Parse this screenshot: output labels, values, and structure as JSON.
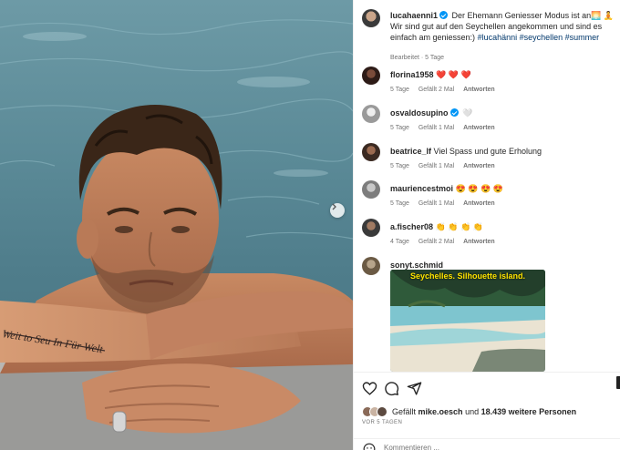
{
  "post": {
    "author": "lucahaenni1",
    "caption_text": "Der Ehemann Geniesser Modus ist an🌅 🧘 Wir sind gut auf den Seychellen angekommen und sind es einfach am geniessen:) ",
    "hashtags": "#lucahänni #seychellen #summer",
    "meta": "Bearbeitet · 5 Tage"
  },
  "comments": [
    {
      "user": "florina1958",
      "text": "❤️ ❤️ ❤️",
      "age": "5 Tage",
      "likes": "Gefällt 2 Mal",
      "reply": "Antworten",
      "verified": false
    },
    {
      "user": "osvaldosupino",
      "text": "🤍",
      "age": "5 Tage",
      "likes": "Gefällt 1 Mal",
      "reply": "Antworten",
      "verified": true
    },
    {
      "user": "beatrice_lf",
      "text": "Viel Spass und gute Erholung",
      "age": "5 Tage",
      "likes": "Gefällt 1 Mal",
      "reply": "Antworten",
      "verified": false
    },
    {
      "user": "mauriencestmoi",
      "text": "😍 😍 😍 😍",
      "age": "5 Tage",
      "likes": "Gefällt 1 Mal",
      "reply": "Antworten",
      "verified": false
    },
    {
      "user": "a.fischer08",
      "text": "👏 👏 👏 👏",
      "age": "4 Tage",
      "likes": "Gefällt 2 Mal",
      "reply": "Antworten",
      "verified": false
    },
    {
      "user": "sonyt.schmid",
      "text": "",
      "age": "",
      "likes": "",
      "reply": "",
      "verified": false
    }
  ],
  "embed": {
    "title": "Seychelles. Silhouette island."
  },
  "likes": {
    "prefix": "Gefällt",
    "user": "mike.oesch",
    "middle": "und",
    "count": "18.439 weitere Personen"
  },
  "age_label": "VOR 5 TAGEN",
  "comment_input": {
    "placeholder": "Kommentieren ..."
  },
  "icons": [
    "heart-icon",
    "comment-icon",
    "share-icon",
    "chevron-right-icon",
    "emoji-icon"
  ],
  "colors": {
    "accent": "#0095f6",
    "heart_red": "#ed4956",
    "link": "#00376b",
    "meta_gray": "#737373"
  }
}
